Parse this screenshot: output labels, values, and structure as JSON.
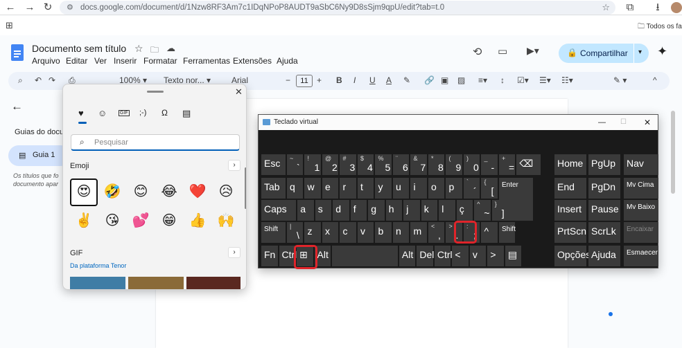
{
  "browser": {
    "url": "docs.google.com/document/d/1Nzw8RF3Am7c1IDqNPoP8AUDT9aSbC6Ny9D8sSjm9qpU/edit?tab=t.0",
    "bookmark": "Todos os fa"
  },
  "doc": {
    "title": "Documento sem título",
    "menus": [
      "Arquivo",
      "Editar",
      "Ver",
      "Inserir",
      "Formatar",
      "Ferramentas",
      "Extensões",
      "Ajuda"
    ],
    "share_label": "Compartilhar"
  },
  "toolbar": {
    "zoom": "100%",
    "style": "Texto nor...",
    "font": "Arial",
    "font_size": "11"
  },
  "sidebar": {
    "heading": "Guias do docu",
    "tab_label": "Guia 1",
    "hint1": "Os títulos que fo",
    "hint2": "documento apar"
  },
  "emoji_panel": {
    "search_placeholder": "Pesquisar",
    "emoji_heading": "Emoji",
    "emojis": [
      "😍",
      "🤣",
      "😊",
      "😂",
      "❤️",
      "😥",
      "✌️",
      "😘",
      "💕",
      "😁",
      "👍",
      "🙌"
    ],
    "gif_heading": "GIF",
    "gif_source": "Da plataforma Tenor",
    "tab_icons": [
      "♥",
      "☺",
      "GIF",
      ";-)",
      "Ω",
      "▤"
    ]
  },
  "osk": {
    "title": "Teclado virtual",
    "rows": [
      [
        {
          "m": "Esc"
        },
        {
          "s": "~",
          "b": "`"
        },
        {
          "s": "!",
          "b": "1"
        },
        {
          "s": "@",
          "b": "2"
        },
        {
          "s": "#",
          "b": "3"
        },
        {
          "s": "$",
          "b": "4"
        },
        {
          "s": "%",
          "b": "5"
        },
        {
          "s": "¨",
          "b": "6"
        },
        {
          "s": "&",
          "b": "7"
        },
        {
          "s": "*",
          "b": "8"
        },
        {
          "s": "(",
          "b": "9"
        },
        {
          "s": ")",
          "b": "0"
        },
        {
          "s": "_",
          "b": "-"
        },
        {
          "s": "+",
          "b": "="
        },
        {
          "m": "⌫"
        }
      ],
      [
        {
          "m": "Tab"
        },
        {
          "m": "q"
        },
        {
          "m": "w"
        },
        {
          "m": "e"
        },
        {
          "m": "r"
        },
        {
          "m": "t"
        },
        {
          "m": "y"
        },
        {
          "m": "u"
        },
        {
          "m": "i"
        },
        {
          "m": "o"
        },
        {
          "m": "p"
        },
        {
          "s": "`",
          "b": "´"
        },
        {
          "s": "{",
          "b": "["
        },
        {
          "m": "Enter"
        }
      ],
      [
        {
          "m": "Caps"
        },
        {
          "m": "a"
        },
        {
          "m": "s"
        },
        {
          "m": "d"
        },
        {
          "m": "f"
        },
        {
          "m": "g"
        },
        {
          "m": "h"
        },
        {
          "m": "j"
        },
        {
          "m": "k"
        },
        {
          "m": "l"
        },
        {
          "m": "ç"
        },
        {
          "s": "^",
          "b": "~"
        },
        {
          "s": "}",
          "b": "]"
        }
      ],
      [
        {
          "m": "Shift"
        },
        {
          "s": "|",
          "b": "\\"
        },
        {
          "m": "z"
        },
        {
          "m": "x"
        },
        {
          "m": "c"
        },
        {
          "m": "v"
        },
        {
          "m": "b"
        },
        {
          "m": "n"
        },
        {
          "m": "m"
        },
        {
          "s": "<",
          "b": ","
        },
        {
          "s": ">",
          "b": "."
        },
        {
          "s": ":",
          "b": ";"
        },
        {
          "m": "^"
        },
        {
          "m": "Shift"
        }
      ],
      [
        {
          "m": "Fn"
        },
        {
          "m": "Ctrl"
        },
        {
          "m": "⊞"
        },
        {
          "m": "Alt"
        },
        {
          "m": ""
        },
        {
          "m": "Alt"
        },
        {
          "m": "Del"
        },
        {
          "m": "Ctrl"
        },
        {
          "m": "<"
        },
        {
          "m": "v"
        },
        {
          "m": ">"
        },
        {
          "m": "▤"
        }
      ]
    ],
    "nav": [
      [
        "Home",
        "PgUp",
        "Nav"
      ],
      [
        "End",
        "PgDn",
        "Mv Cima"
      ],
      [
        "Insert",
        "Pause",
        "Mv Baixo"
      ],
      [
        "PrtScn",
        "ScrLk",
        "Encaixar"
      ],
      [
        "Opções",
        "Ajuda",
        "Esmaecer"
      ]
    ]
  }
}
